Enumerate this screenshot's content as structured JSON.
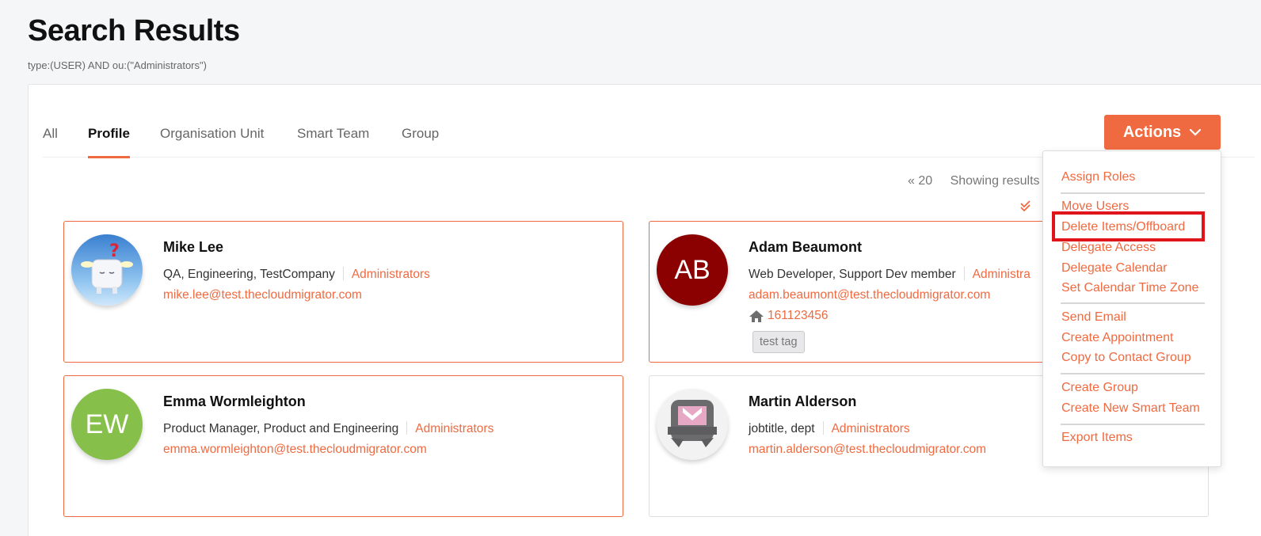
{
  "page": {
    "title": "Search Results",
    "query": "type:(USER) AND ou:(\"Administrators\")"
  },
  "tabs": [
    {
      "label": "All"
    },
    {
      "label": "Profile"
    },
    {
      "label": "Organisation Unit"
    },
    {
      "label": "Smart Team"
    },
    {
      "label": "Group"
    }
  ],
  "actions": {
    "label": "Actions"
  },
  "paging": {
    "prev": "« 20",
    "summary": "Showing results"
  },
  "cards": [
    {
      "name": "Mike Lee",
      "details": "QA, Engineering, TestCompany",
      "ou": "Administrators",
      "email": "mike.lee@test.thecloudmigrator.com",
      "avatar": "image"
    },
    {
      "name": "Adam Beaumont",
      "details": "Web Developer, Support Dev member",
      "ou": "Administra",
      "email": "adam.beaumont@test.thecloudmigrator.com",
      "phone": "161123456",
      "tag": "test tag",
      "initials": "AB",
      "color": "#8b0000"
    },
    {
      "name": "Emma Wormleighton",
      "details": "Product Manager, Product and Engineering",
      "ou": "Administrators",
      "email": "emma.wormleighton@test.thecloudmigrator.com",
      "initials": "EW",
      "color": "#86c04a"
    },
    {
      "name": "Martin Alderson",
      "details": "jobtitle, dept",
      "ou": "Administrators",
      "email": "martin.alderson@test.thecloudmigrator.com",
      "avatar": "image"
    }
  ],
  "menu": {
    "items": [
      "Assign Roles",
      "Move Users",
      "Delete Items/Offboard",
      "Delegate Access",
      "Delegate Calendar",
      "Set Calendar Time Zone",
      "Send Email",
      "Create Appointment",
      "Copy to Contact Group",
      "Create Group",
      "Create New Smart Team",
      "Export Items"
    ]
  },
  "colors": {
    "accent": "#ef6a40",
    "highlight": "#e0141b"
  },
  "icons": [
    "chevron-down-icon",
    "double-check-icon",
    "home-icon"
  ]
}
